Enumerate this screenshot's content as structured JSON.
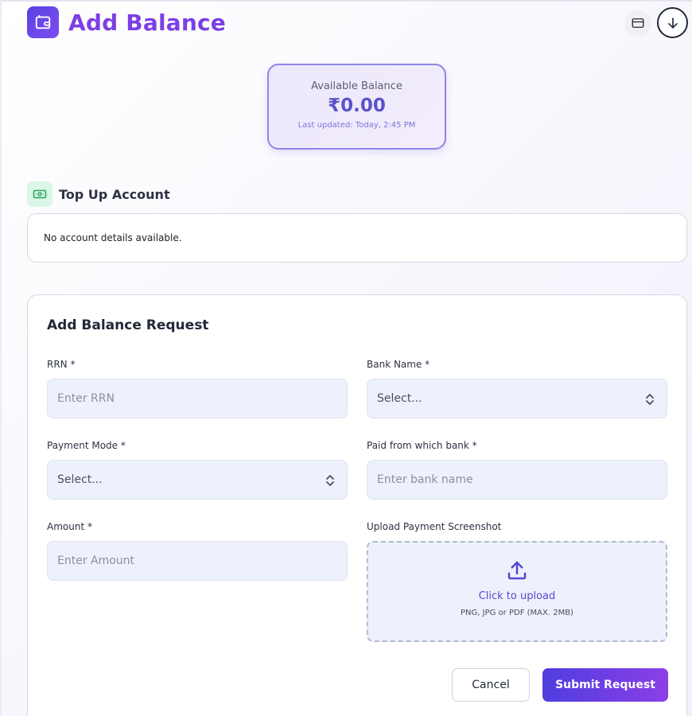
{
  "header": {
    "title": "Add Balance"
  },
  "balance": {
    "label": "Available Balance",
    "amount": "₹0.00",
    "updated": "Last updated: Today, 2:45 PM"
  },
  "topup": {
    "title": "Top Up Account",
    "message": "No account details available."
  },
  "form": {
    "title": "Add Balance Request",
    "rrn": {
      "label": "RRN *",
      "placeholder": "Enter RRN"
    },
    "bank_name": {
      "label": "Bank Name *",
      "value": "Select..."
    },
    "payment_mode": {
      "label": "Payment Mode *",
      "value": "Select..."
    },
    "paid_from": {
      "label": "Paid from which bank *",
      "placeholder": "Enter bank name"
    },
    "amount": {
      "label": "Amount *",
      "placeholder": "Enter Amount"
    },
    "upload": {
      "label": "Upload Payment Screenshot",
      "action": "Click to upload",
      "hint": "PNG, JPG or PDF (MAX. 2MB)"
    },
    "cancel_label": "Cancel",
    "submit_label": "Submit Request"
  },
  "colors": {
    "brand": "#7b3fe4",
    "accent": "#5a53c9",
    "success": "#22a45d"
  },
  "icons": {
    "header": "wallet-icon",
    "card": "credit-card-icon",
    "download": "arrow-down-circle-icon",
    "topup": "banknote-icon",
    "upload": "upload-icon",
    "select": "chevron-up-down-icon"
  }
}
